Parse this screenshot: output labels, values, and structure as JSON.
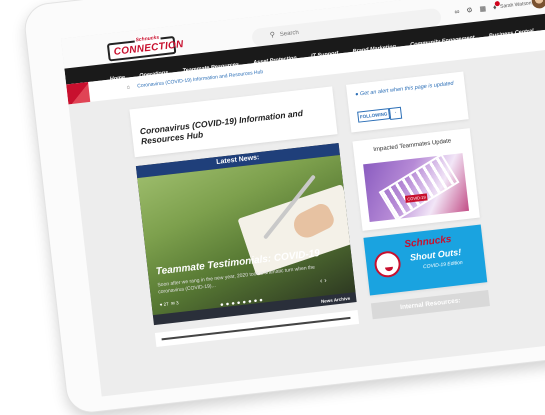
{
  "header": {
    "logo_top": "Schnucks",
    "logo_main": "CONNECTION",
    "search_placeholder": "Search",
    "user_name": "Sarah Watson",
    "nav": [
      "Home",
      "Operations",
      "Teammate Resources",
      "Asset Protection",
      "IT Support",
      "Brand Marketing",
      "Community Engagement",
      "Business Central"
    ]
  },
  "breadcrumb": {
    "current": "Coronavirus (COVID-19) Information and Resources Hub"
  },
  "page_title": "Coronavirus (COVID-19) Information and Resources Hub",
  "alert": {
    "text": "Get an alert when this page is updated",
    "follow_label": "FOLLOWING"
  },
  "news": {
    "heading": "Latest News:",
    "title": "Teammate Testimonials: COVID-19",
    "excerpt": "Soon after we rang in the new year, 2020 took a dramatic turn when the coronavirus (COVID-19)...",
    "likes": "27",
    "comments": "3",
    "archive_label": "News Archive"
  },
  "impacted": {
    "title": "Impacted Teammates Update"
  },
  "shoutouts": {
    "brand": "Schnucks",
    "title": "Shout Outs!",
    "subtitle": "COVID-19 Edition"
  },
  "internal": {
    "title": "Internal Resources:"
  },
  "colors": {
    "brand_red": "#c8102e",
    "nav_bg": "#1a1a1a",
    "link_blue": "#2c6fb7",
    "news_header": "#1f3f7a",
    "shout_bg": "#1aa3e0"
  }
}
